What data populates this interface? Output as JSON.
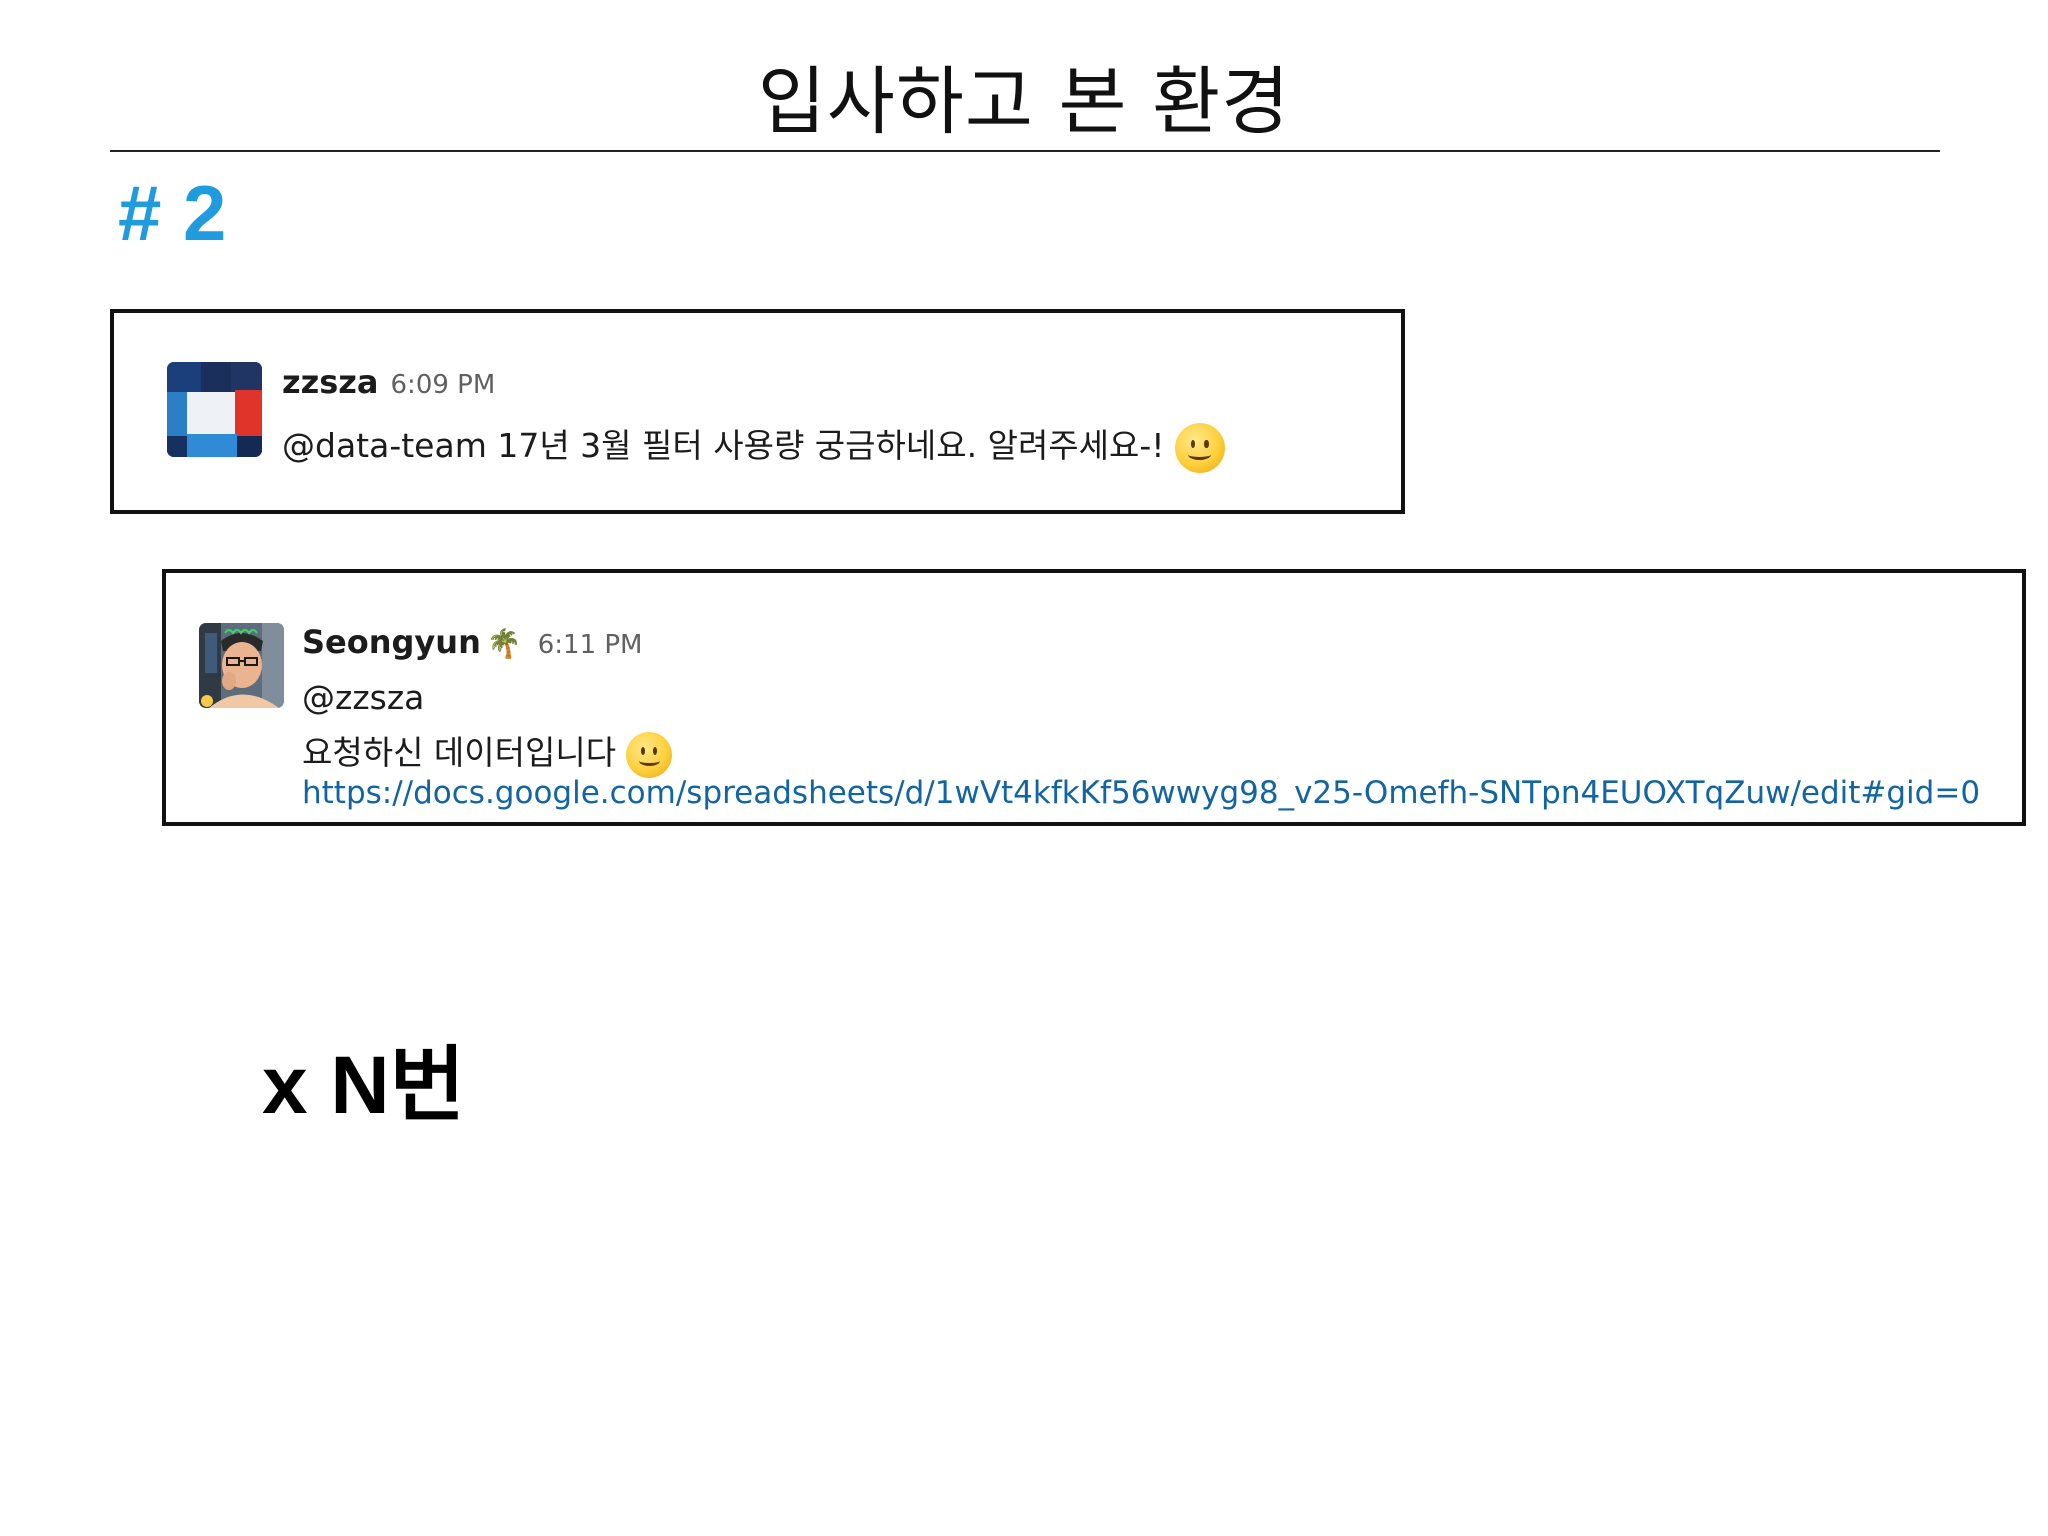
{
  "slide": {
    "title": "입사하고 본 환경",
    "section_number": "# 2",
    "callout": "x N번"
  },
  "messages": [
    {
      "author": "zzsza",
      "time": "6:09 PM",
      "text": "@data-team 17년 3월 필터 사용량 궁금하네요. 알려주세요-!",
      "emoji": "slightly-smiling-face"
    },
    {
      "author": "Seongyun",
      "status_emoji": "🌴",
      "time": "6:11 PM",
      "mention": "@zzsza",
      "text": "요청하신 데이터입니다",
      "emoji": "slightly-smiling-face",
      "link": "https://docs.google.com/spreadsheets/d/1wVt4kfkKf56wwyg98_v25-Omefh-SNTpn4EUOXTqZuw/edit#gid=0"
    }
  ],
  "colors": {
    "accent": "#1f9bde",
    "link": "#1264a3",
    "text": "#1d1c1d",
    "muted": "#616061"
  }
}
